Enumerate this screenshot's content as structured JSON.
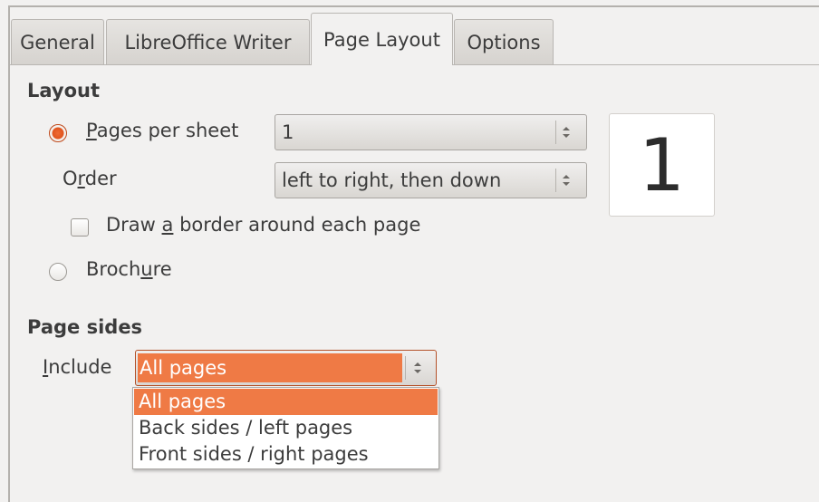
{
  "tabs": [
    {
      "label": "General"
    },
    {
      "label": "LibreOffice Writer"
    },
    {
      "label": "Page Layout"
    },
    {
      "label": "Options"
    }
  ],
  "active_tab": "Page Layout",
  "layout": {
    "title": "Layout",
    "pages_per_sheet": {
      "pre": "",
      "mnemonic": "P",
      "post": "ages per sheet",
      "checked": true,
      "value": "1"
    },
    "order": {
      "pre": "O",
      "mnemonic": "r",
      "post": "der",
      "value": "left to right, then down"
    },
    "draw_border": {
      "pre": "Draw ",
      "mnemonic": "a",
      "post": " border around each page",
      "checked": false
    },
    "brochure": {
      "pre": "Broch",
      "mnemonic": "u",
      "post": "re",
      "checked": false
    },
    "preview_number": "1"
  },
  "page_sides": {
    "title": "Page sides",
    "include": {
      "pre": "",
      "mnemonic": "I",
      "post": "nclude"
    },
    "selected": "All pages",
    "options": [
      "All pages",
      "Back sides / left pages",
      "Front sides / right pages"
    ]
  },
  "colors": {
    "accent": "#ef7a45",
    "radio_checked": "#e0541e",
    "window_bg": "#f2f1f0"
  }
}
